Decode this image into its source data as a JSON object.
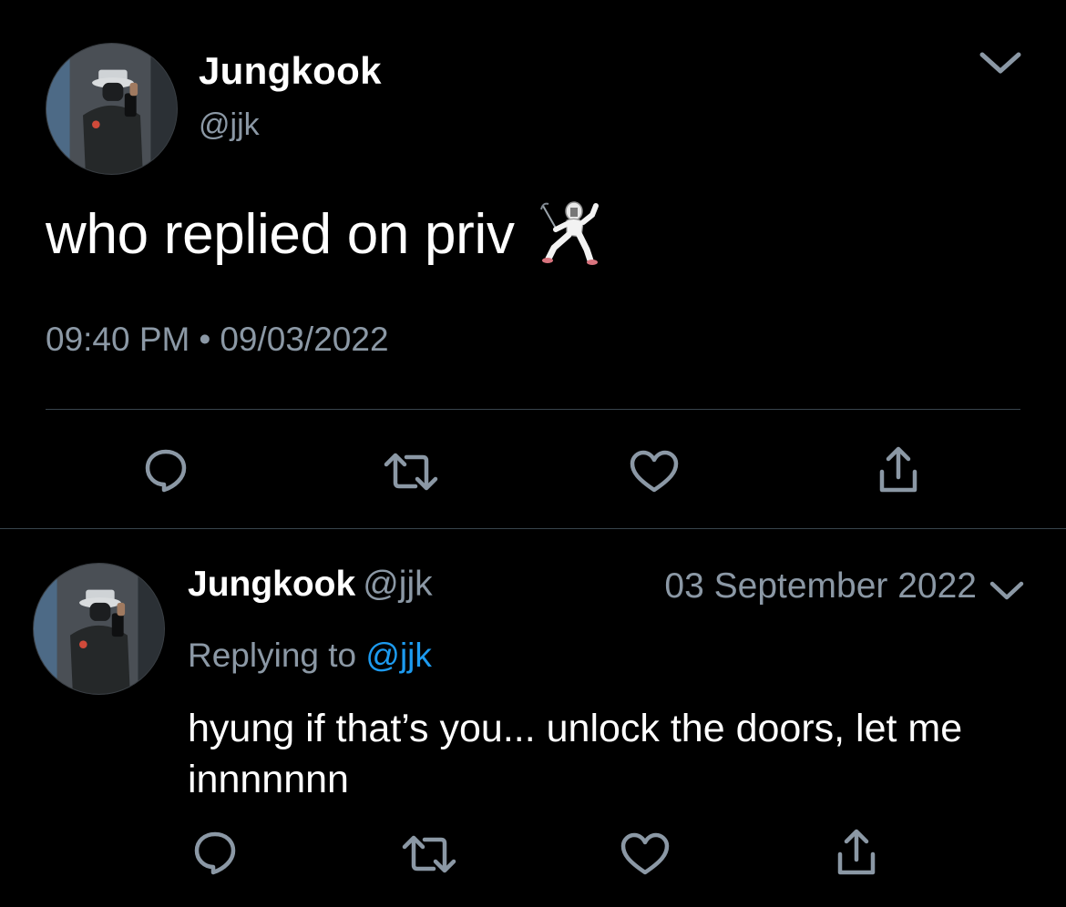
{
  "main_tweet": {
    "author_name": "Jungkook",
    "author_handle": "@jjk",
    "text": "who replied on priv",
    "emoji": "person-fencing",
    "time": "09:40 PM",
    "separator": "•",
    "date": "09/03/2022"
  },
  "reply_tweet": {
    "author_name": "Jungkook",
    "author_handle": "@jjk",
    "date": "03 September 2022",
    "replying_to_label": "Replying to",
    "replying_to_handle": "@jjk",
    "text": "hyung if that’s you... unlock the doors, let me innnnnnn"
  },
  "actions": [
    {
      "name": "reply",
      "icon": "reply-icon"
    },
    {
      "name": "retweet",
      "icon": "retweet-icon"
    },
    {
      "name": "like",
      "icon": "heart-icon"
    },
    {
      "name": "share",
      "icon": "share-icon"
    }
  ],
  "colors": {
    "background": "#000000",
    "primary_text": "#ffffff",
    "secondary_text": "#8b98a5",
    "mention": "#1d9bf0",
    "divider": "#38444d",
    "icon": "#8b98a5"
  }
}
